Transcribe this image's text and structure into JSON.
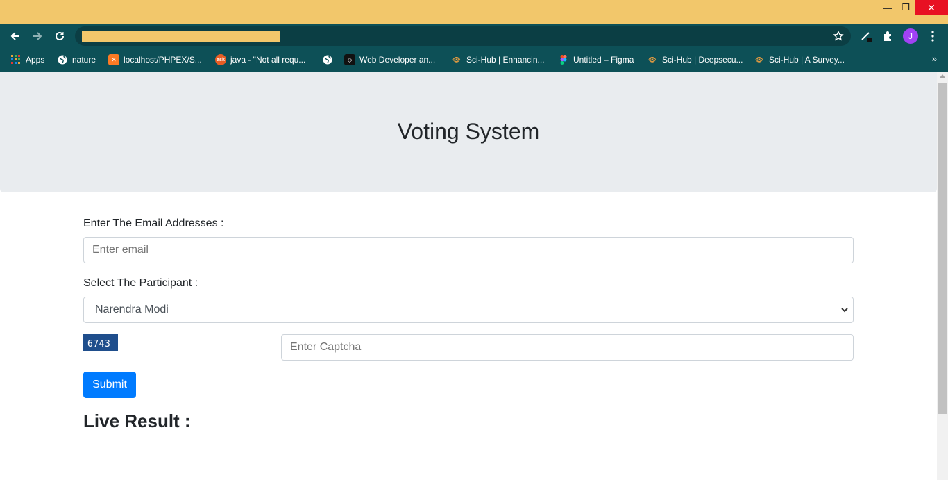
{
  "window": {
    "minimize": "—",
    "restore": "❐",
    "close": "✕"
  },
  "toolbar": {
    "avatar_letter": "J"
  },
  "bookmarks": [
    {
      "label": "Apps",
      "icon": "apps-grid-icon"
    },
    {
      "label": "nature",
      "icon": "globe-icon"
    },
    {
      "label": "localhost/PHPEX/S...",
      "icon": "xampp-icon"
    },
    {
      "label": "java - \"Not all requ...",
      "icon": "ask-icon"
    },
    {
      "label": "",
      "icon": "globe-icon"
    },
    {
      "label": "Web Developer an...",
      "icon": "webdev-icon"
    },
    {
      "label": "Sci-Hub | Enhancin...",
      "icon": "scihub-icon"
    },
    {
      "label": "Untitled – Figma",
      "icon": "figma-icon"
    },
    {
      "label": "Sci-Hub | Deepsecu...",
      "icon": "scihub-icon"
    },
    {
      "label": "Sci-Hub | A Survey...",
      "icon": "scihub-icon"
    }
  ],
  "bookmarks_more": "»",
  "page": {
    "title": "Voting System",
    "email_label": "Enter The Email Addresses :",
    "email_placeholder": "Enter email",
    "participant_label": "Select The Participant :",
    "participant_selected": "Narendra Modi",
    "captcha_code": "6743",
    "captcha_placeholder": "Enter Captcha",
    "submit_label": "Submit",
    "live_result_heading": "Live Result :"
  },
  "colors": {
    "title_bar": "#f2c76b",
    "toolbar": "#0d5057",
    "primary": "#007bff",
    "jumbotron": "#e9ecef",
    "captcha_bg": "#1f4e8c"
  }
}
